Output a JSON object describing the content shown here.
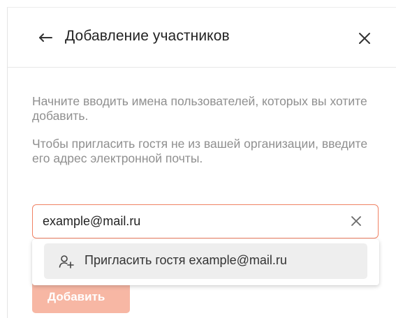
{
  "dialog": {
    "title": "Добавление участников",
    "back_icon": "arrow-left-icon",
    "close_icon": "close-icon"
  },
  "hints": {
    "line1": "Начните вводить имена пользователей, которых вы хотите добавить.",
    "line2": "Чтобы пригласить гостя не из вашей организации, введите его адрес электронной почты."
  },
  "search": {
    "value": "example@mail.ru",
    "clear_icon": "clear-icon",
    "border_color": "#f08264"
  },
  "suggestion": {
    "icon": "user-plus-icon",
    "label": "Пригласить гостя example@mail.ru"
  },
  "actions": {
    "add_label": "Добавить",
    "add_color": "#f7b7a4"
  }
}
